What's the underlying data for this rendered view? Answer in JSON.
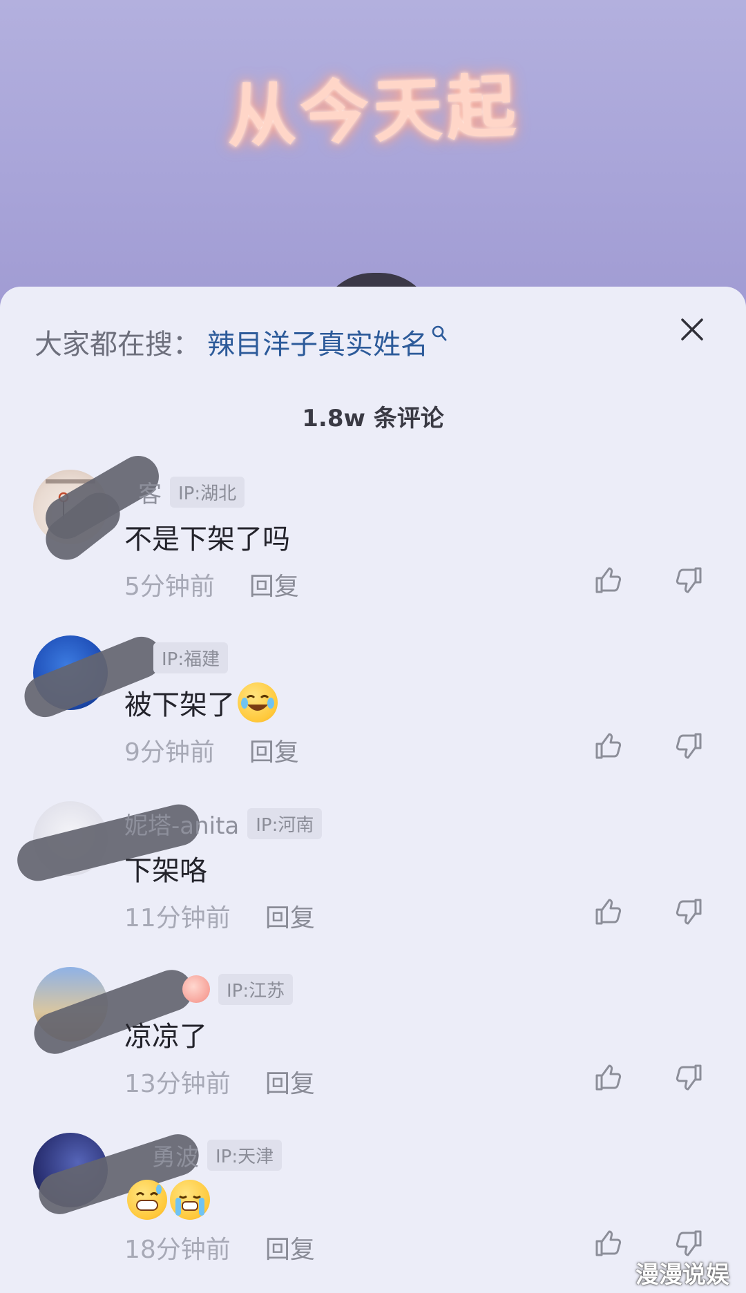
{
  "video": {
    "title": "从今天起"
  },
  "search": {
    "label": "大家都在搜：",
    "term": "辣目洋子真实姓名"
  },
  "comments_header": {
    "count": "1.8w  条评论"
  },
  "comments": [
    {
      "name": "客",
      "ip": "IP:湖北",
      "text": "不是下架了吗",
      "time": "5分钟前",
      "reply": "回复"
    },
    {
      "name": "",
      "ip": "IP:福建",
      "text": "被下架了",
      "time": "9分钟前",
      "reply": "回复"
    },
    {
      "name": "妮塔-anita",
      "ip": "IP:河南",
      "text": "下架咯",
      "time": "11分钟前",
      "reply": "回复"
    },
    {
      "name": "",
      "ip": "IP:江苏",
      "text": "凉凉了",
      "time": "13分钟前",
      "reply": "回复"
    },
    {
      "name": "勇波",
      "ip": "IP:天津",
      "text": "",
      "time": "18分钟前",
      "reply": "回复"
    }
  ],
  "watermark": "漫漫说娱",
  "colors": {
    "accent_link": "#2d5b9a",
    "sheet_bg": "#ecedf8",
    "video_bg": "#a9a6d8"
  },
  "icons": [
    "search-icon",
    "close-icon",
    "thumbs-up-icon",
    "thumbs-down-icon"
  ]
}
